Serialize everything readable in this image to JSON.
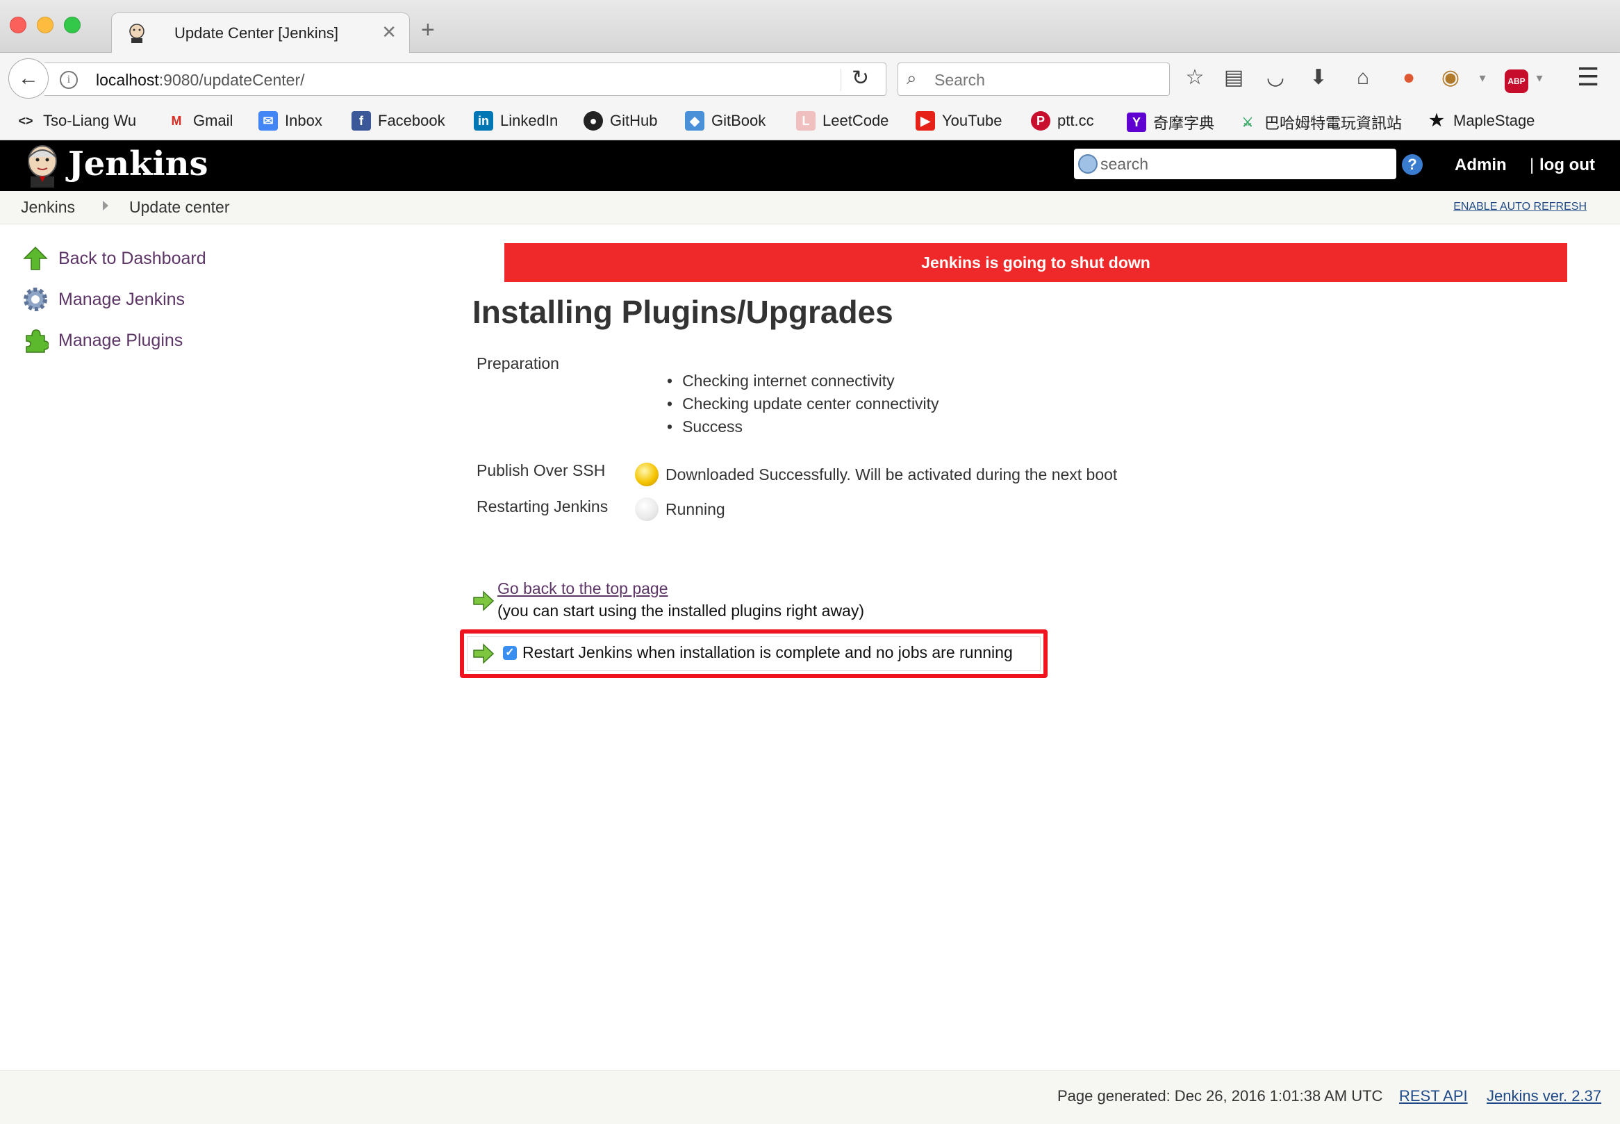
{
  "browser": {
    "tab_title": "Update Center [Jenkins]",
    "url_host": "localhost",
    "url_path": ":9080/updateCenter/",
    "search_placeholder": "Search",
    "bookmarks": [
      {
        "label": "Tso-Liang Wu",
        "icon": "code-icon"
      },
      {
        "label": "Gmail",
        "icon": "gmail-icon"
      },
      {
        "label": "Inbox",
        "icon": "inbox-icon"
      },
      {
        "label": "Facebook",
        "icon": "facebook-icon"
      },
      {
        "label": "LinkedIn",
        "icon": "linkedin-icon"
      },
      {
        "label": "GitHub",
        "icon": "github-icon"
      },
      {
        "label": "GitBook",
        "icon": "gitbook-icon"
      },
      {
        "label": "LeetCode",
        "icon": "leetcode-icon"
      },
      {
        "label": "YouTube",
        "icon": "youtube-icon"
      },
      {
        "label": "ptt.cc",
        "icon": "ptt-icon"
      },
      {
        "label": "奇摩字典",
        "icon": "yahoo-icon"
      },
      {
        "label": "巴哈姆特電玩資訊站",
        "icon": "bahamut-icon"
      },
      {
        "label": "MapleStage",
        "icon": "star-icon"
      }
    ]
  },
  "header": {
    "brand": "Jenkins",
    "search_placeholder": "search",
    "help": "?",
    "user": "Admin",
    "separator": "|",
    "logout": "log out"
  },
  "breadcrumb": {
    "items": [
      "Jenkins",
      "Update center"
    ],
    "auto_refresh": "ENABLE AUTO REFRESH"
  },
  "sidebar": {
    "tasks": [
      {
        "label": "Back to Dashboard",
        "icon": "up-arrow-icon"
      },
      {
        "label": "Manage Jenkins",
        "icon": "gear-icon"
      },
      {
        "label": "Manage Plugins",
        "icon": "puzzle-icon"
      }
    ]
  },
  "main": {
    "banner": "Jenkins is going to shut down",
    "title": "Installing Plugins/Upgrades",
    "preparation_label": "Preparation",
    "preparation_steps": [
      "Checking internet connectivity",
      "Checking update center connectivity",
      "Success"
    ],
    "jobs": [
      {
        "name": "Publish Over SSH",
        "status": "Downloaded Successfully. Will be activated during the next boot",
        "status_color": "#f5c400"
      },
      {
        "name": "Restarting Jenkins",
        "status": "Running",
        "status_color": "#e9e9e9"
      }
    ],
    "top_link": "Go back to the top page",
    "top_note": "(you can start using the installed plugins right away)",
    "restart_label": "Restart Jenkins when installation is complete and no jobs are running",
    "restart_checked": true
  },
  "footer": {
    "generated": "Page generated: Dec 26, 2016 1:01:38 AM UTC",
    "rest_api": "REST API",
    "version": "Jenkins ver. 2.37"
  },
  "colors": {
    "banner": "#ef2929",
    "highlight_box": "#f0141e",
    "link": "#5c3566"
  }
}
